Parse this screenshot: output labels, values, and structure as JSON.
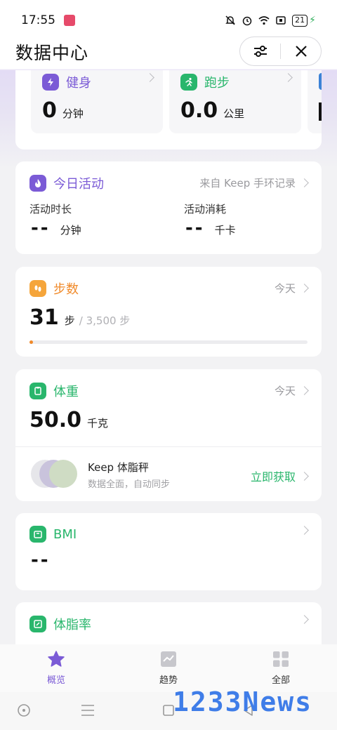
{
  "status_bar": {
    "time": "17:55",
    "battery": "21"
  },
  "header": {
    "title": "数据中心"
  },
  "sport_tiles": [
    {
      "label": "健身",
      "value": "0",
      "unit": "分钟",
      "color": "#7b5bd6"
    },
    {
      "label": "跑步",
      "value": "0.0",
      "unit": "公里",
      "color": "#29b66c"
    }
  ],
  "activity": {
    "title": "今日活动",
    "source": "来自 Keep 手环记录",
    "duration_label": "活动时长",
    "duration_value": "--",
    "duration_unit": "分钟",
    "calorie_label": "活动消耗",
    "calorie_value": "--",
    "calorie_unit": "千卡",
    "color": "#7b5bd6"
  },
  "steps": {
    "title": "步数",
    "date": "今天",
    "value": "31",
    "unit": "步",
    "goal": "/ 3,500 步",
    "progress_fraction": 0.009,
    "color": "#f5a53b"
  },
  "weight": {
    "title": "体重",
    "date": "今天",
    "value": "50.0",
    "unit": "千克",
    "color": "#29b66c",
    "promo": {
      "name": "Keep 体脂秤",
      "desc": "数据全面，自动同步",
      "action": "立即获取"
    }
  },
  "bmi": {
    "title": "BMI",
    "value": "--",
    "color": "#29b66c"
  },
  "body_fat": {
    "title": "体脂率",
    "color": "#29b66c"
  },
  "tabs": [
    {
      "label": "概览",
      "active": true
    },
    {
      "label": "趋势",
      "active": false
    },
    {
      "label": "全部",
      "active": false
    }
  ],
  "watermark": "1233News",
  "colors": {
    "accent": "#7b5bd6",
    "green": "#29b66c",
    "orange": "#f5a53b",
    "background": "#f2f2f4"
  }
}
